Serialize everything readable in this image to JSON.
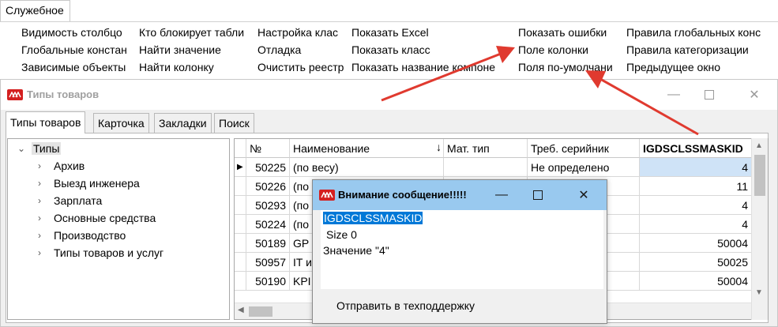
{
  "ribbon": {
    "tab_label": "Служебное",
    "columns": [
      [
        "Видимость  столбцо",
        "Глобальные констан",
        "Зависимые объекты"
      ],
      [
        "Кто блокирует табли",
        "Найти значение",
        "Найти колонку"
      ],
      [
        "Настройка клас",
        "Отладка",
        "Очистить реестр"
      ],
      [
        "Показать Excel",
        "Показать класс",
        "Показать название компоне"
      ],
      [
        "Показать ошибки",
        "Поле колонки",
        "Поля по-умолчани"
      ],
      [
        "Правила глобальных конс",
        "Правила категоризации",
        "Предыдущее окно"
      ]
    ]
  },
  "window": {
    "title": "Типы товаров",
    "tabs": [
      "Типы товаров",
      "Карточка",
      "Закладки",
      "Поиск"
    ]
  },
  "tree": {
    "root": "Типы",
    "children": [
      "Архив",
      "Выезд инженера",
      "Зарплата",
      "Основные средства",
      "Производство",
      "Типы товаров и услуг"
    ]
  },
  "grid": {
    "headers": [
      "№",
      "Наименование",
      "Мат. тип",
      "Треб. серийник",
      "IGDSCLSSMASKID"
    ],
    "rows": [
      [
        "50225",
        "(по весу)",
        "",
        "Не определено",
        "4"
      ],
      [
        "50226",
        "(по",
        "",
        "о",
        "11"
      ],
      [
        "50293",
        "(по",
        "",
        "о",
        "4"
      ],
      [
        "50224",
        "(по",
        "",
        "о",
        "4"
      ],
      [
        "50189",
        "GP",
        "",
        "о",
        "50004"
      ],
      [
        "50957",
        "IT и",
        "",
        "о",
        "50025"
      ],
      [
        "50190",
        "KPI",
        "",
        "о",
        "50004"
      ]
    ]
  },
  "dialog": {
    "title": "Внимание сообщение!!!!!",
    "field_name": "IGDSCLSSMASKID",
    "size_text": "Size 0",
    "value_text": "Значение \"4\"",
    "button_label": "Отправить в техподдержку"
  },
  "colors": {
    "accent_arrow": "#e03a2f",
    "selection": "#0078d7",
    "dialog_title_bg": "#99c9ef",
    "logo_red": "#d42020"
  }
}
